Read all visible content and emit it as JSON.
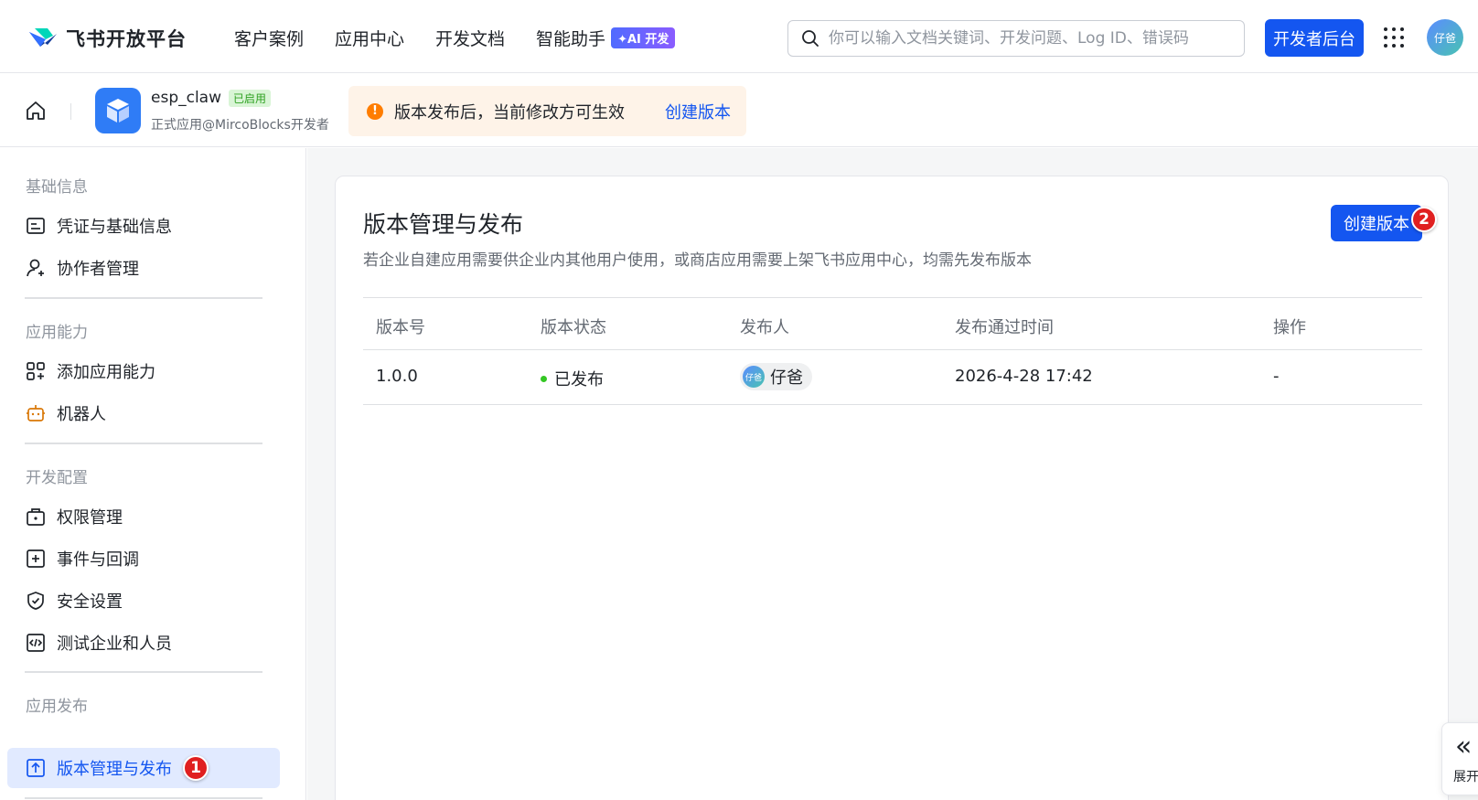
{
  "topnav": {
    "logo_text": "飞书开放平台",
    "links": [
      "客户案例",
      "应用中心",
      "开发文档",
      "智能助手"
    ],
    "ai_badge": "✦AI 开发",
    "search_placeholder": "你可以输入文档关键词、开发问题、Log ID、错误码",
    "dev_console": "开发者后台",
    "avatar_text": "仔爸"
  },
  "subheader": {
    "app_name": "esp_claw",
    "app_status": "已启用",
    "app_subtitle": "正式应用@MircoBlocks开发者",
    "notice_text": "版本发布后，当前修改方可生效",
    "notice_link": "创建版本"
  },
  "sidebar": {
    "sections": [
      {
        "title": "基础信息",
        "items": [
          "凭证与基础信息",
          "协作者管理"
        ]
      },
      {
        "title": "应用能力",
        "items": [
          "添加应用能力",
          "机器人"
        ]
      },
      {
        "title": "开发配置",
        "items": [
          "权限管理",
          "事件与回调",
          "安全设置",
          "测试企业和人员"
        ]
      },
      {
        "title": "应用发布",
        "items": [
          "版本管理与发布"
        ]
      }
    ],
    "step1": "1"
  },
  "main": {
    "title": "版本管理与发布",
    "description": "若企业自建应用需要供企业内其他用户使用，或商店应用需要上架飞书应用中心，均需先发布版本",
    "create_button": "创建版本",
    "step2": "2",
    "table": {
      "headers": [
        "版本号",
        "版本状态",
        "发布人",
        "发布通过时间",
        "操作"
      ],
      "rows": [
        {
          "version": "1.0.0",
          "status": "已发布",
          "publisher": "仔爸",
          "publisher_avatar": "仔爸",
          "time": "2026-4-28 17:42",
          "action": "-"
        }
      ]
    }
  },
  "expand": {
    "label": "展开"
  },
  "colors": {
    "primary": "#1456f0",
    "warning": "#ff7d00",
    "success": "#34c724",
    "step_badge": "#e02020"
  }
}
